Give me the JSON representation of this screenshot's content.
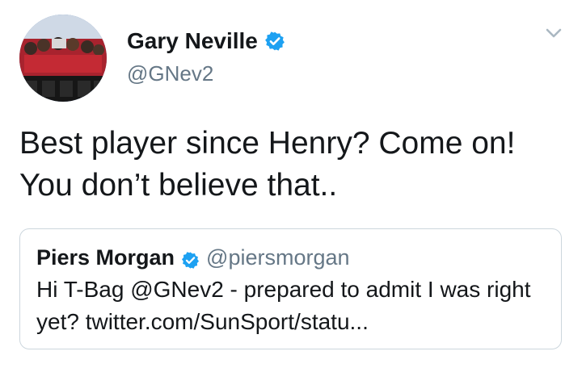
{
  "tweet": {
    "author_name": "Gary Neville",
    "author_handle": "@GNev2",
    "text": "Best player since Henry? Come on! You don’t believe that.."
  },
  "quoted_tweet": {
    "author_name": "Piers Morgan",
    "author_handle": "@piersmorgan",
    "text": "Hi T-Bag @GNev2 - prepared to admit I was right yet? twitter.com/SunSport/statu..."
  },
  "icons": {
    "verified": "verified-badge-icon",
    "menu": "chevron-down-icon"
  },
  "colors": {
    "verified_blue": "#1da1f2",
    "secondary_text": "#657786",
    "border": "#ccd6dd"
  }
}
